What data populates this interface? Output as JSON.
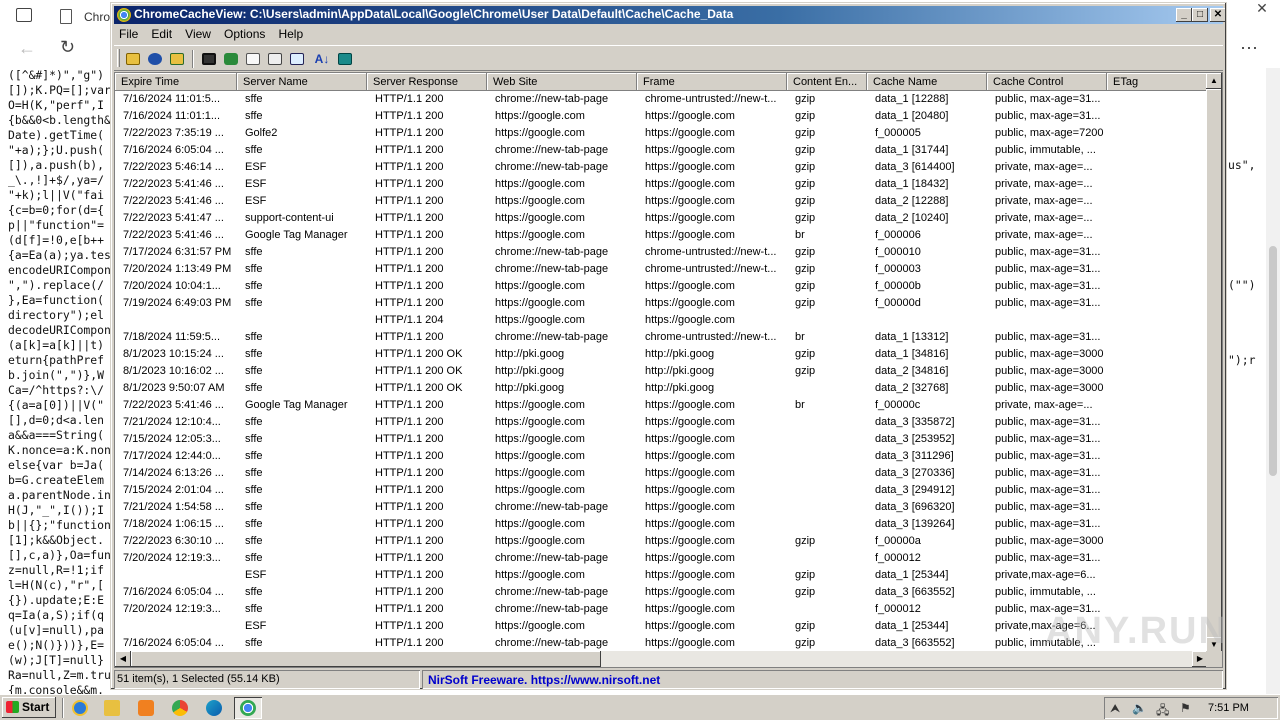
{
  "background": {
    "tab_label": "Chro",
    "code_left": [
      "([^&#]*)\",\"g\")",
      "[]);K.PQ=[];var",
      "O=H(K,\"perf\",I",
      "{b&&0<b.length&",
      "Date).getTime(",
      "\"+a);};U.push(",
      "[]),a.push(b),",
      "_\\.,!]+$/,ya=/",
      "\"+k);l||V(\"fai",
      "{c=b=0;for(d={",
      "p||\"function\"=",
      "(d[f]=!0,e[b++",
      "{a=Ea(a);ya.tes",
      "encodeURICompon",
      "\",\").replace(/",
      "},Ea=function(",
      "directory\");el",
      "decodeURICompon",
      "(a[k]=a[k]||t)",
      "eturn{pathPref",
      "b.join(\",\")},W",
      "Ca=/^https?:\\/",
      "{(a=a[0])||V(\"",
      "[],d=0;d<a.len",
      "a&&a===String(",
      "K.nonce=a:K.non",
      "else{var b=Ja(",
      "b=G.createElem",
      "a.parentNode.in",
      "H(J,\"_\",I());I",
      "b||{};\"function",
      "[1];k&&Object.",
      "[],c,a)},Oa=fun",
      "z=null,R=!1;if",
      "l=H(N(c),\"r\",[",
      "{}).update;E:E",
      "q=Ia(a,S);if(q",
      "(u[v]=null),pa",
      "e();N()}))},E=",
      "(w);J[T]=null}",
      "Ra=null,Z=m.tru",
      "{m.console&&m."
    ],
    "code_right": [
      "",
      "",
      "",
      "",
      "",
      "",
      "us\",",
      "",
      "",
      "",
      "",
      "",
      "",
      "",
      "(\"\")",
      "",
      "",
      "",
      "",
      "\");r"
    ]
  },
  "window": {
    "title": "ChromeCacheView:  C:\\Users\\admin\\AppData\\Local\\Google\\Chrome\\User Data\\Default\\Cache\\Cache_Data",
    "menu": [
      "File",
      "Edit",
      "View",
      "Options",
      "Help"
    ]
  },
  "columns": [
    "Expire Time",
    "Server Name",
    "Server Response",
    "Web Site",
    "Frame",
    "Content En...",
    "Cache Name",
    "Cache Control",
    "ETag"
  ],
  "rows": [
    [
      "7/16/2024 11:01:5...",
      "sffe",
      "HTTP/1.1 200",
      "chrome://new-tab-page",
      "chrome-untrusted://new-t...",
      "gzip",
      "data_1  [12288]",
      "public, max-age=31...",
      ""
    ],
    [
      "7/16/2024 11:01:1...",
      "sffe",
      "HTTP/1.1 200",
      "https://google.com",
      "https://google.com",
      "gzip",
      "data_1  [20480]",
      "public, max-age=31...",
      ""
    ],
    [
      "7/22/2023 7:35:19 ...",
      "Golfe2",
      "HTTP/1.1 200",
      "https://google.com",
      "https://google.com",
      "gzip",
      "f_000005",
      "public, max-age=7200",
      ""
    ],
    [
      "7/16/2024 6:05:04 ...",
      "sffe",
      "HTTP/1.1 200",
      "chrome://new-tab-page",
      "https://google.com",
      "gzip",
      "data_1  [31744]",
      "public, immutable, ...",
      ""
    ],
    [
      "7/22/2023 5:46:14 ...",
      "ESF",
      "HTTP/1.1 200",
      "chrome://new-tab-page",
      "https://google.com",
      "gzip",
      "data_3  [614400]",
      "private, max-age=...",
      ""
    ],
    [
      "7/22/2023 5:41:46 ...",
      "ESF",
      "HTTP/1.1 200",
      "https://google.com",
      "https://google.com",
      "gzip",
      "data_1  [18432]",
      "private, max-age=...",
      ""
    ],
    [
      "7/22/2023 5:41:46 ...",
      "ESF",
      "HTTP/1.1 200",
      "https://google.com",
      "https://google.com",
      "gzip",
      "data_2  [12288]",
      "private, max-age=...",
      ""
    ],
    [
      "7/22/2023 5:41:47 ...",
      "support-content-ui",
      "HTTP/1.1 200",
      "https://google.com",
      "https://google.com",
      "gzip",
      "data_2  [10240]",
      "private, max-age=...",
      ""
    ],
    [
      "7/22/2023 5:41:46 ...",
      "Google Tag Manager",
      "HTTP/1.1 200",
      "https://google.com",
      "https://google.com",
      "br",
      "f_000006",
      "private, max-age=...",
      ""
    ],
    [
      "7/17/2024 6:31:57 PM",
      "sffe",
      "HTTP/1.1 200",
      "chrome://new-tab-page",
      "chrome-untrusted://new-t...",
      "gzip",
      "f_000010",
      "public, max-age=31...",
      ""
    ],
    [
      "7/20/2024 1:13:49 PM",
      "sffe",
      "HTTP/1.1 200",
      "chrome://new-tab-page",
      "chrome-untrusted://new-t...",
      "gzip",
      "f_000003",
      "public, max-age=31...",
      ""
    ],
    [
      "7/20/2024 10:04:1...",
      "sffe",
      "HTTP/1.1 200",
      "https://google.com",
      "https://google.com",
      "gzip",
      "f_00000b",
      "public, max-age=31...",
      ""
    ],
    [
      "7/19/2024 6:49:03 PM",
      "sffe",
      "HTTP/1.1 200",
      "https://google.com",
      "https://google.com",
      "gzip",
      "f_00000d",
      "public, max-age=31...",
      ""
    ],
    [
      "",
      "",
      "HTTP/1.1 204",
      "https://google.com",
      "https://google.com",
      "",
      "",
      "",
      ""
    ],
    [
      "7/18/2024 11:59:5...",
      "sffe",
      "HTTP/1.1 200",
      "chrome://new-tab-page",
      "chrome-untrusted://new-t...",
      "br",
      "data_1  [13312]",
      "public, max-age=31...",
      ""
    ],
    [
      "8/1/2023 10:15:24 ...",
      "sffe",
      "HTTP/1.1 200 OK",
      "http://pki.goog",
      "http://pki.goog",
      "gzip",
      "data_1  [34816]",
      "public, max-age=3000",
      ""
    ],
    [
      "8/1/2023 10:16:02 ...",
      "sffe",
      "HTTP/1.1 200 OK",
      "http://pki.goog",
      "http://pki.goog",
      "gzip",
      "data_2  [34816]",
      "public, max-age=3000",
      ""
    ],
    [
      "8/1/2023 9:50:07 AM",
      "sffe",
      "HTTP/1.1 200 OK",
      "http://pki.goog",
      "http://pki.goog",
      "",
      "data_2  [32768]",
      "public, max-age=3000",
      ""
    ],
    [
      "7/22/2023 5:41:46 ...",
      "Google Tag Manager",
      "HTTP/1.1 200",
      "https://google.com",
      "https://google.com",
      "br",
      "f_00000c",
      "private, max-age=...",
      ""
    ],
    [
      "7/21/2024 12:10:4...",
      "sffe",
      "HTTP/1.1 200",
      "https://google.com",
      "https://google.com",
      "",
      "data_3  [335872]",
      "public, max-age=31...",
      ""
    ],
    [
      "7/15/2024 12:05:3...",
      "sffe",
      "HTTP/1.1 200",
      "https://google.com",
      "https://google.com",
      "",
      "data_3  [253952]",
      "public, max-age=31...",
      ""
    ],
    [
      "7/17/2024 12:44:0...",
      "sffe",
      "HTTP/1.1 200",
      "https://google.com",
      "https://google.com",
      "",
      "data_3  [311296]",
      "public, max-age=31...",
      ""
    ],
    [
      "7/14/2024 6:13:26 ...",
      "sffe",
      "HTTP/1.1 200",
      "https://google.com",
      "https://google.com",
      "",
      "data_3  [270336]",
      "public, max-age=31...",
      ""
    ],
    [
      "7/15/2024 2:01:04 ...",
      "sffe",
      "HTTP/1.1 200",
      "https://google.com",
      "https://google.com",
      "",
      "data_3  [294912]",
      "public, max-age=31...",
      ""
    ],
    [
      "7/21/2024 1:54:58 ...",
      "sffe",
      "HTTP/1.1 200",
      "chrome://new-tab-page",
      "https://google.com",
      "",
      "data_3  [696320]",
      "public, max-age=31...",
      ""
    ],
    [
      "7/18/2024 1:06:15 ...",
      "sffe",
      "HTTP/1.1 200",
      "https://google.com",
      "https://google.com",
      "",
      "data_3  [139264]",
      "public, max-age=31...",
      ""
    ],
    [
      "7/22/2023 6:30:10 ...",
      "sffe",
      "HTTP/1.1 200",
      "https://google.com",
      "https://google.com",
      "gzip",
      "f_00000a",
      "public, max-age=3000",
      ""
    ],
    [
      "7/20/2024 12:19:3...",
      "sffe",
      "HTTP/1.1 200",
      "chrome://new-tab-page",
      "https://google.com",
      "",
      "f_000012",
      "public, max-age=31...",
      ""
    ],
    [
      "",
      "ESF",
      "HTTP/1.1 200",
      "https://google.com",
      "https://google.com",
      "gzip",
      "data_1  [25344]",
      "private,max-age=6...",
      ""
    ],
    [
      "7/16/2024 6:05:04 ...",
      "sffe",
      "HTTP/1.1 200",
      "chrome://new-tab-page",
      "https://google.com",
      "gzip",
      "data_3  [663552]",
      "public, immutable, ...",
      ""
    ],
    [
      "7/20/2024 12:19:3...",
      "sffe",
      "HTTP/1.1 200",
      "chrome://new-tab-page",
      "https://google.com",
      "",
      "f_000012",
      "public, max-age=31...",
      ""
    ],
    [
      "",
      "ESF",
      "HTTP/1.1 200",
      "https://google.com",
      "https://google.com",
      "gzip",
      "data_1  [25344]",
      "private,max-age=6...",
      ""
    ],
    [
      "7/16/2024 6:05:04 ...",
      "sffe",
      "HTTP/1.1 200",
      "chrome://new-tab-page",
      "https://google.com",
      "gzip",
      "data_3  [663552]",
      "public, immutable, ...",
      ""
    ]
  ],
  "status": {
    "count": "51 item(s), 1 Selected  (55.14 KB)",
    "link": "NirSoft Freeware.  https://www.nirsoft.net"
  },
  "taskbar": {
    "start": "Start",
    "clock": "7:51 PM"
  },
  "watermark": "ANY.RUN",
  "colors": {
    "titlebar_start": "#0a246a",
    "titlebar_end": "#a6caf0",
    "link": "#0000cc",
    "face": "#d4d0c8"
  }
}
